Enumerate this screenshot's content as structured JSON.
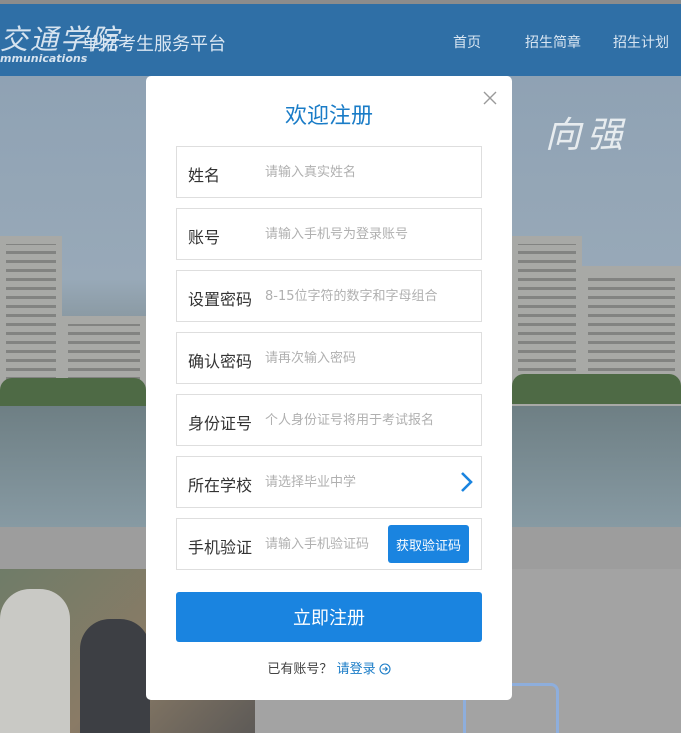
{
  "header": {
    "logo_cn": "交通学院",
    "logo_en": "mmunications",
    "site_title": "单招考生服务平台",
    "nav": [
      "首页",
      "招生简章",
      "招生计划"
    ]
  },
  "banner": {
    "calligraphy": "向强"
  },
  "modal": {
    "title": "欢迎注册",
    "close_icon": "close-icon",
    "fields": [
      {
        "label": "姓名",
        "placeholder": "请输入真实姓名"
      },
      {
        "label": "账号",
        "placeholder": "请输入手机号为登录账号"
      },
      {
        "label": "设置密码",
        "placeholder": "8-15位字符的数字和字母组合"
      },
      {
        "label": "确认密码",
        "placeholder": "请再次输入密码"
      },
      {
        "label": "身份证号",
        "placeholder": "个人身份证号将用于考试报名"
      },
      {
        "label": "所在学校",
        "placeholder": "请选择毕业中学"
      },
      {
        "label": "手机验证",
        "placeholder": "请输入手机验证码"
      }
    ],
    "get_code_label": "获取验证码",
    "submit_label": "立即注册",
    "login_prompt": "已有账号？",
    "login_link": "请登录"
  },
  "colors": {
    "accent": "#1a84e0",
    "title": "#1a7cc7",
    "header_bg": "#2f6fa6"
  }
}
